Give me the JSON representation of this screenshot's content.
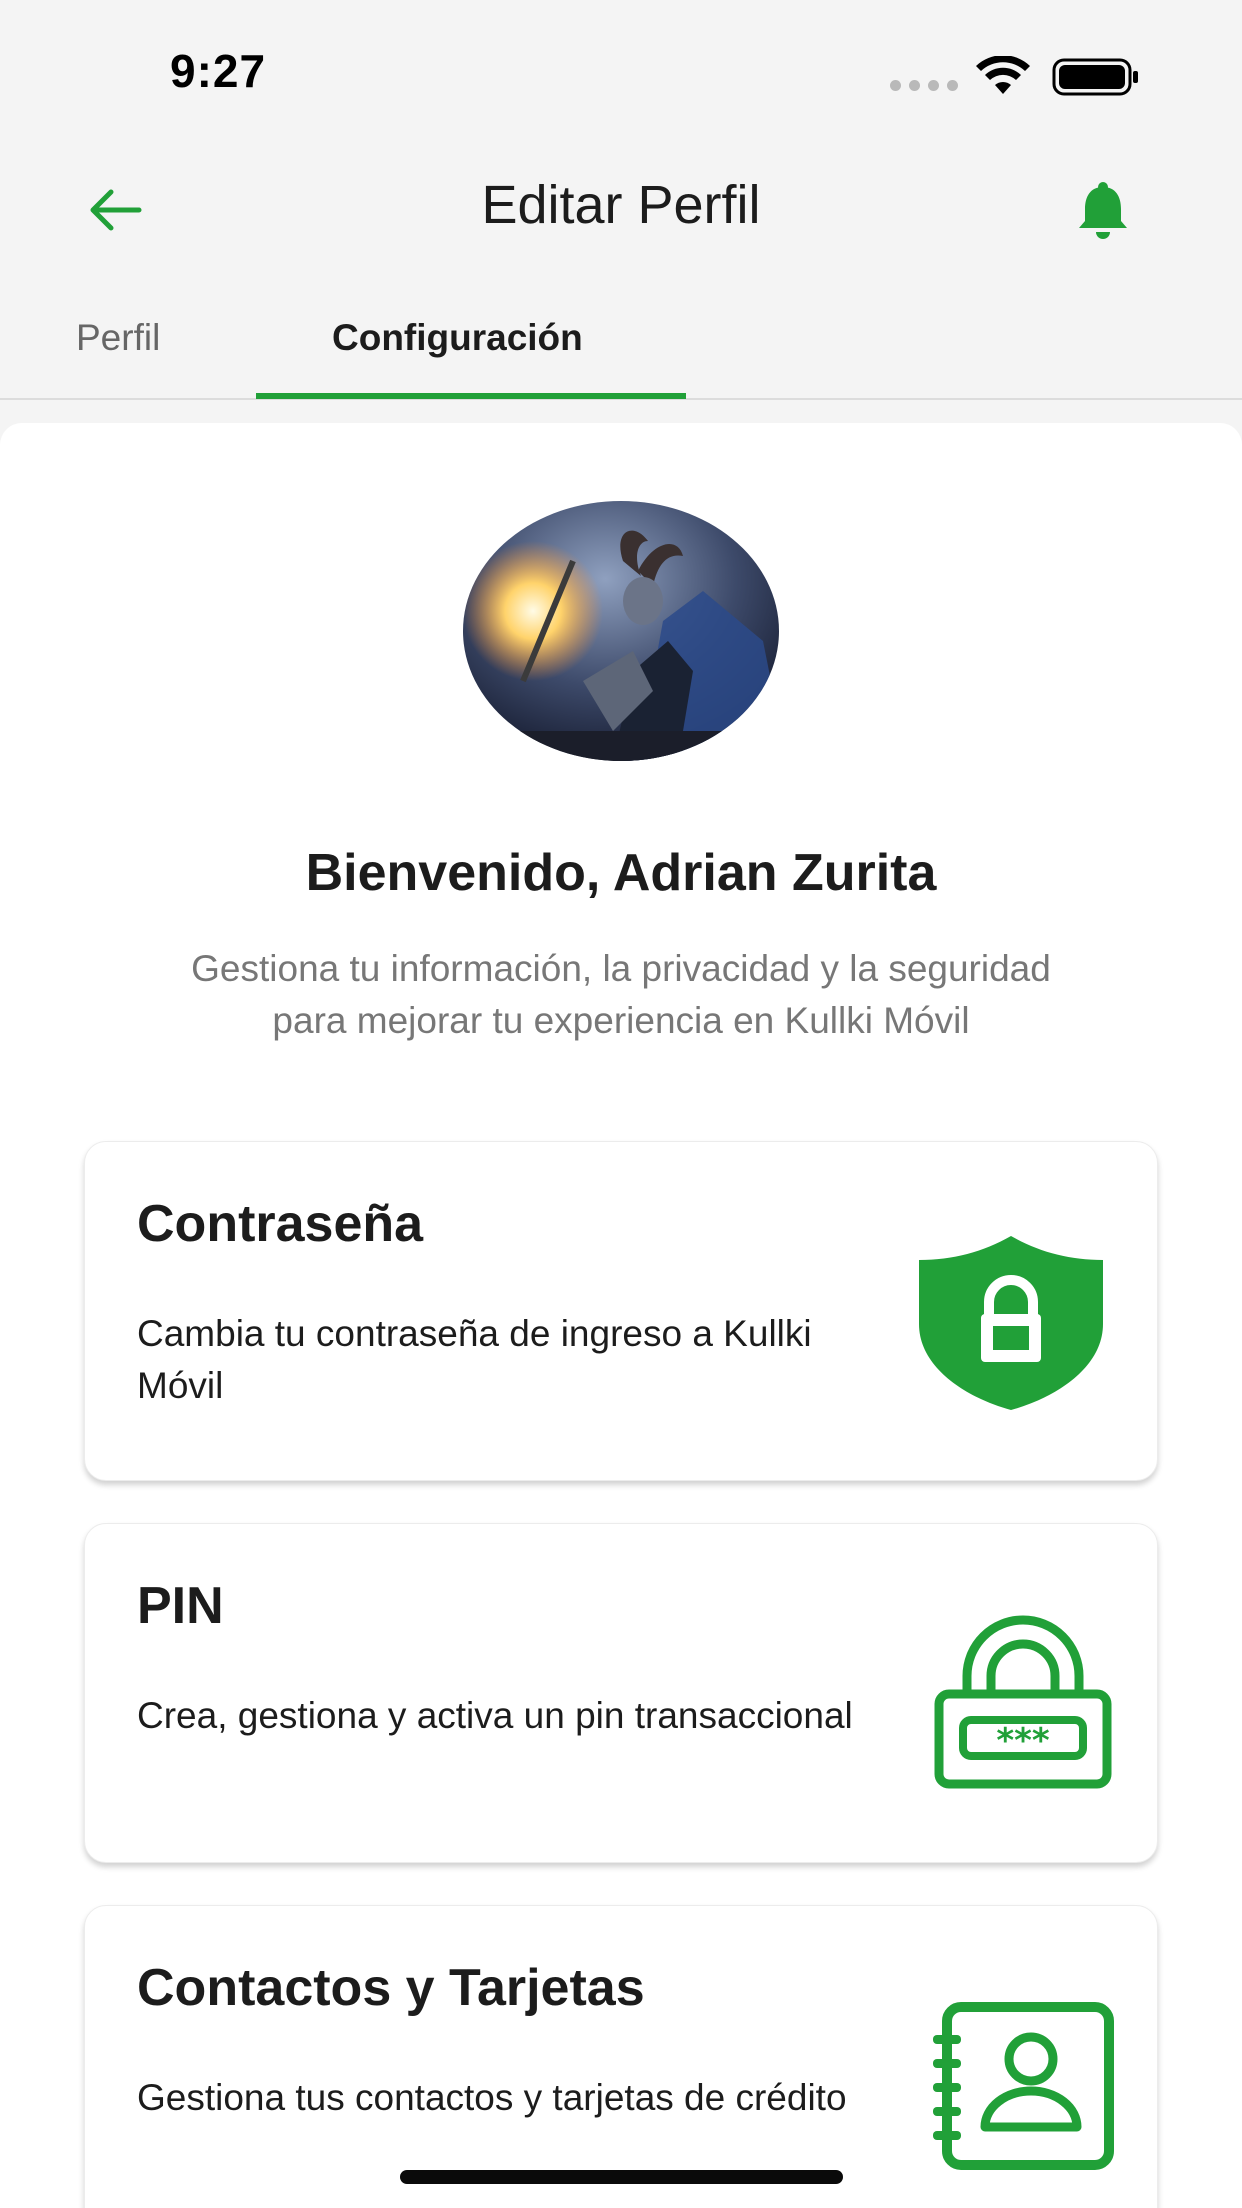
{
  "status_bar": {
    "time": "9:27",
    "icons": [
      "signal-icon",
      "wifi-icon",
      "battery-icon"
    ]
  },
  "header": {
    "title": "Editar Perfil",
    "back_icon": "arrow-left-icon",
    "notification_icon": "bell-icon"
  },
  "tabs": [
    {
      "label": "Perfil",
      "selected": false
    },
    {
      "label": "Configuración",
      "selected": true
    }
  ],
  "profile": {
    "welcome": "Bienvenido, Adrian Zurita",
    "intro_line1": "Gestiona tu información, la privacidad y la seguridad",
    "intro_line2": "para mejorar tu experiencia en Kullki Móvil"
  },
  "cards": [
    {
      "title": "Contraseña",
      "description": "Cambia tu contraseña de ingreso a Kullki Móvil",
      "icon": "shield-lock-icon"
    },
    {
      "title": "PIN",
      "description": "Crea, gestiona y activa un pin transaccional",
      "icon": "padlock-pin-icon"
    },
    {
      "title": "Contactos y Tarjetas",
      "description": "Gestiona tus contactos y tarjetas de crédito",
      "icon": "contact-book-icon"
    }
  ],
  "colors": {
    "accent": "#21a038",
    "background": "#f4f4f4",
    "card": "#ffffff",
    "muted_text": "#777777"
  }
}
